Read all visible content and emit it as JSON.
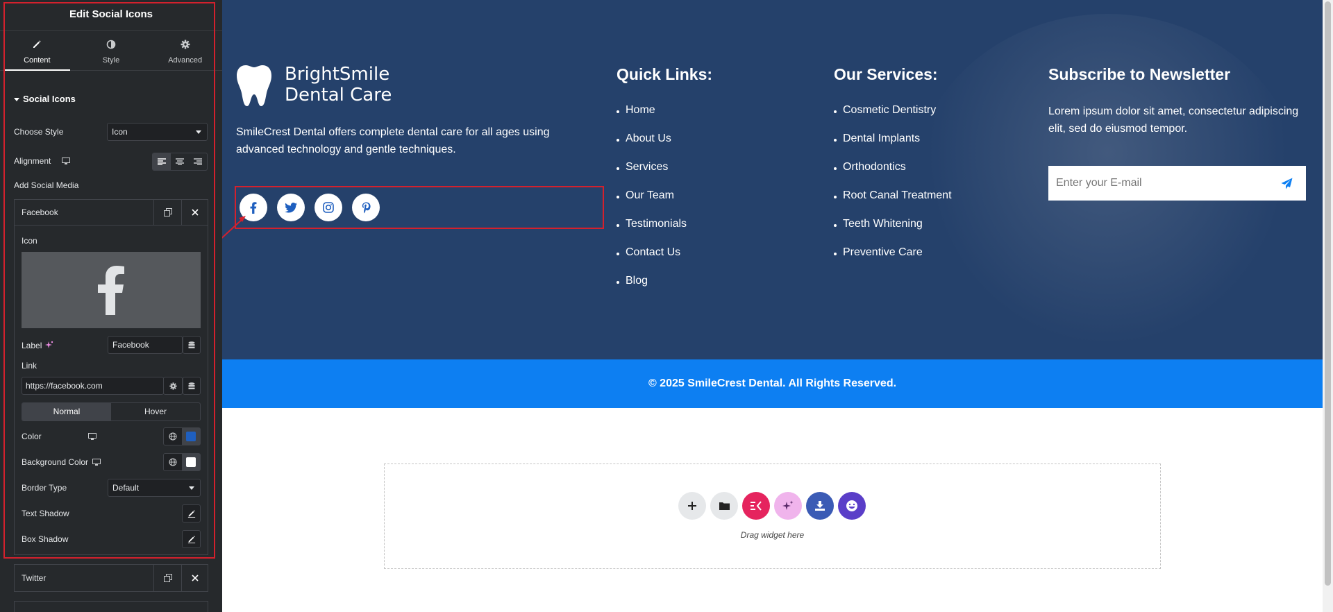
{
  "panel": {
    "title": "Edit Social Icons",
    "tabs": [
      {
        "label": "Content",
        "icon": "pencil-icon"
      },
      {
        "label": "Style",
        "icon": "contrast-icon"
      },
      {
        "label": "Advanced",
        "icon": "gear-icon"
      }
    ],
    "section_title": "Social Icons",
    "choose_style_label": "Choose Style",
    "choose_style_value": "Icon",
    "alignment_label": "Alignment",
    "add_social_label": "Add Social Media",
    "item_facebook": "Facebook",
    "icon_label": "Icon",
    "label_label": "Label",
    "label_value": "Facebook",
    "link_label": "Link",
    "link_value": "https://facebook.com",
    "state_normal": "Normal",
    "state_hover": "Hover",
    "color_label": "Color",
    "bg_color_label": "Background Color",
    "border_type_label": "Border Type",
    "border_type_value": "Default",
    "text_shadow_label": "Text Shadow",
    "box_shadow_label": "Box Shadow",
    "item_twitter": "Twitter",
    "color_swatch": "#1f5fbf",
    "bg_swatch": "#ffffff"
  },
  "site": {
    "brand_line1": "BrightSmile",
    "brand_line2": "Dental Care",
    "description": "SmileCrest Dental offers complete dental care for all ages using advanced technology and gentle techniques.",
    "social": [
      "facebook-icon",
      "twitter-icon",
      "instagram-icon",
      "pinterest-icon"
    ],
    "quick_links_title": "Quick Links:",
    "quick_links": [
      "Home",
      "About Us",
      "Services",
      "Our Team",
      "Testimonials",
      "Contact Us",
      "Blog"
    ],
    "services_title": "Our Services:",
    "services": [
      "Cosmetic Dentistry",
      "Dental Implants",
      "Orthodontics",
      "Root Canal Treatment",
      "Teeth Whitening",
      "Preventive Care"
    ],
    "newsletter_title": "Subscribe to Newsletter",
    "newsletter_text": "Lorem ipsum dolor sit amet, consectetur adipiscing elit, sed do eiusmod tempor.",
    "email_placeholder": "Enter your E-mail",
    "copyright": "© 2025 SmileCrest Dental. All Rights Reserved.",
    "drop_hint": "Drag widget here",
    "colors": {
      "footer_bg": "#25416b",
      "copyright_bg": "#0d7ff2",
      "panel_bg": "#26292c",
      "highlight": "#d3212d"
    }
  }
}
